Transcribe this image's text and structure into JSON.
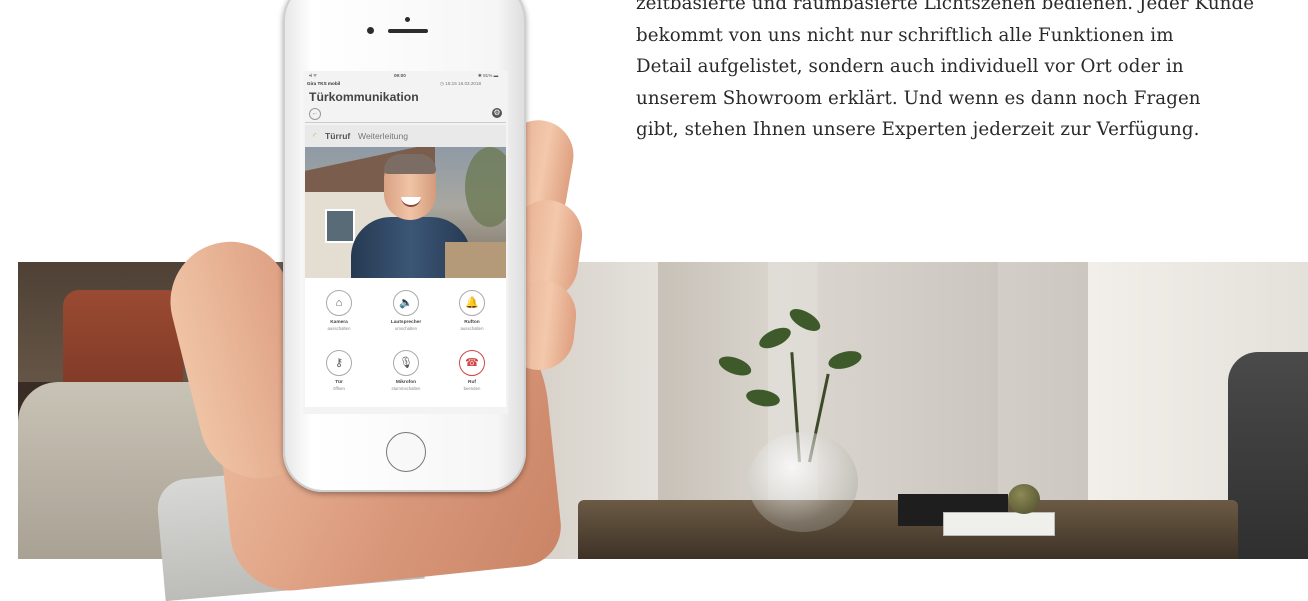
{
  "copy": {
    "lines": [
      "zeitbasierte und raumbasierte Lichtszenen bedienen. Jeder Kunde",
      "bekommt von uns nicht nur schriftlich alle Funktionen im",
      "Detail aufgelistet, sondern auch individuell vor Ort oder in",
      "unserem Showroom erklärt. Und wenn es dann noch Fragen",
      "gibt, stehen Ihnen unsere Experten jederzeit zur Verfügung."
    ]
  },
  "phone_app": {
    "status": {
      "signal": "•ıl ᯤ",
      "time": "09:00",
      "battery": "✱ 81% ▬",
      "carrier": "Gira TKS mobil",
      "stamp": "◷ 15:15 16.03.2018"
    },
    "title": "Türkommunikation",
    "call_header": {
      "icon": "bell-icon",
      "strong": "Türruf",
      "light": "Weiterleitung"
    },
    "controls": [
      {
        "icon": "camera-icon",
        "glyph": "⌂",
        "label": "Kamera",
        "sub": "ausschalten"
      },
      {
        "icon": "speaker-icon",
        "glyph": "🔈",
        "label": "Lautsprecher",
        "sub": "umschalten"
      },
      {
        "icon": "bell-icon",
        "glyph": "🔔",
        "label": "Rufton",
        "sub": "ausschalten"
      },
      {
        "icon": "key-icon",
        "glyph": "⚷",
        "label": "Tür",
        "sub": "öffnen"
      },
      {
        "icon": "microphone-icon",
        "glyph": "🎙",
        "label": "Mikrofon",
        "sub": "stummschalten"
      },
      {
        "icon": "hangup-icon",
        "glyph": "☎",
        "label": "Ruf",
        "sub": "beenden"
      }
    ]
  },
  "colors": {
    "accent_end_call": "#d04545",
    "text": "#2a2a2a"
  }
}
